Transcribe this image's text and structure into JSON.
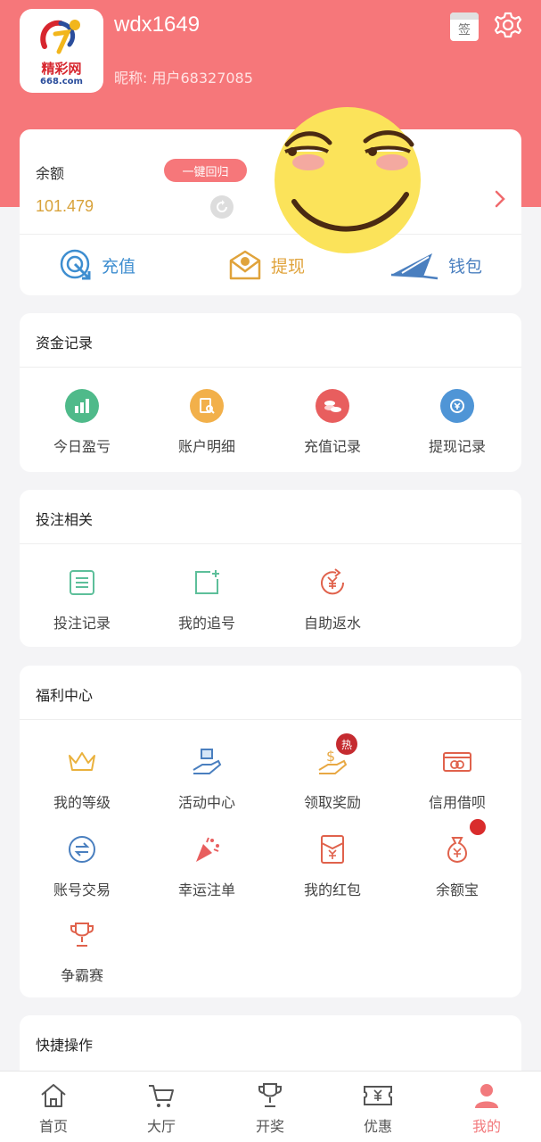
{
  "header": {
    "logo_brand": "精彩网",
    "logo_domain": "668.com",
    "username": "wdx1649",
    "nickname": "昵称: 用户68327085",
    "sign_label": "签"
  },
  "balance": {
    "label": "余额",
    "value": "101.479",
    "recall_button": "一键回归",
    "actions": [
      {
        "label": "充值",
        "icon": "target-arrow-icon"
      },
      {
        "label": "提现",
        "icon": "envelope-icon"
      },
      {
        "label": "钱包",
        "icon": "paper-plane-icon"
      }
    ]
  },
  "funds": {
    "title": "资金记录",
    "items": [
      {
        "label": "今日盈亏",
        "icon": "bar-chart-icon",
        "color": "#4fba8a"
      },
      {
        "label": "账户明细",
        "icon": "document-search-icon",
        "color": "#f2b04a"
      },
      {
        "label": "充值记录",
        "icon": "coins-icon",
        "color": "#e85e5e"
      },
      {
        "label": "提现记录",
        "icon": "yuan-clock-icon",
        "color": "#4f95d6"
      }
    ]
  },
  "bets": {
    "title": "投注相关",
    "items": [
      {
        "label": "投注记录",
        "icon": "list-icon"
      },
      {
        "label": "我的追号",
        "icon": "add-square-icon"
      },
      {
        "label": "自助返水",
        "icon": "yuan-refresh-icon"
      }
    ]
  },
  "welfare": {
    "title": "福利中心",
    "hot_badge": "热",
    "items": [
      {
        "label": "我的等级",
        "icon": "crown-icon"
      },
      {
        "label": "活动中心",
        "icon": "gift-hand-icon"
      },
      {
        "label": "领取奖励",
        "icon": "dollar-hand-icon"
      },
      {
        "label": "信用借呗",
        "icon": "credit-card-icon"
      },
      {
        "label": "账号交易",
        "icon": "exchange-icon"
      },
      {
        "label": "幸运注单",
        "icon": "party-popper-icon"
      },
      {
        "label": "我的红包",
        "icon": "red-envelope-icon"
      },
      {
        "label": "余额宝",
        "icon": "money-bag-icon"
      },
      {
        "label": "争霸赛",
        "icon": "trophy-icon"
      }
    ]
  },
  "quick": {
    "title": "快捷操作"
  },
  "tabbar": [
    {
      "label": "首页",
      "icon": "home-icon"
    },
    {
      "label": "大厅",
      "icon": "cart-icon"
    },
    {
      "label": "开奖",
      "icon": "trophy-icon"
    },
    {
      "label": "优惠",
      "icon": "ticket-icon"
    },
    {
      "label": "我的",
      "icon": "user-icon",
      "active": true
    }
  ]
}
